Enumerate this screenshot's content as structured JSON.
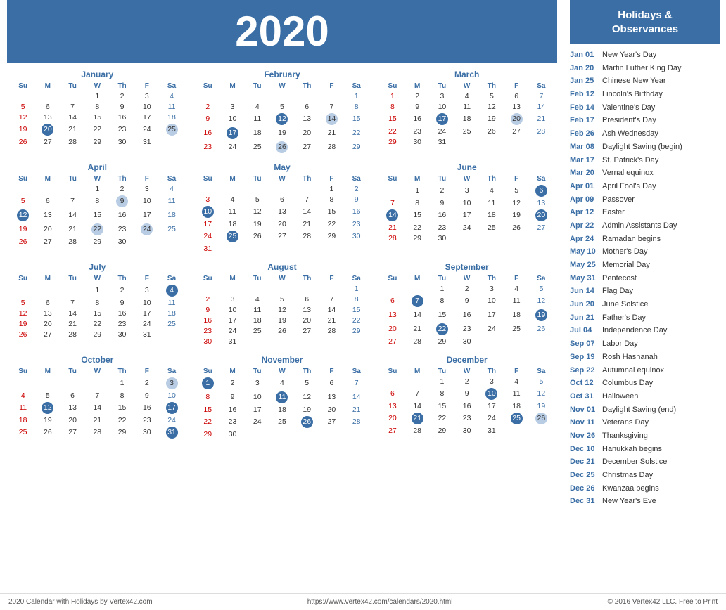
{
  "year": "2020",
  "sidebar_title": "Holidays &\nObservances",
  "footer": {
    "left": "2020 Calendar with Holidays by Vertex42.com",
    "center": "https://www.vertex42.com/calendars/2020.html",
    "right": "© 2016 Vertex42 LLC. Free to Print"
  },
  "holidays": [
    {
      "date": "Jan 01",
      "name": "New Year's Day"
    },
    {
      "date": "Jan 20",
      "name": "Martin Luther King Day"
    },
    {
      "date": "Jan 25",
      "name": "Chinese New Year"
    },
    {
      "date": "Feb 12",
      "name": "Lincoln's Birthday"
    },
    {
      "date": "Feb 14",
      "name": "Valentine's Day"
    },
    {
      "date": "Feb 17",
      "name": "President's Day"
    },
    {
      "date": "Feb 26",
      "name": "Ash Wednesday"
    },
    {
      "date": "Mar 08",
      "name": "Daylight Saving (begin)"
    },
    {
      "date": "Mar 17",
      "name": "St. Patrick's Day"
    },
    {
      "date": "Mar 20",
      "name": "Vernal equinox"
    },
    {
      "date": "Apr 01",
      "name": "April Fool's Day"
    },
    {
      "date": "Apr 09",
      "name": "Passover"
    },
    {
      "date": "Apr 12",
      "name": "Easter"
    },
    {
      "date": "Apr 22",
      "name": "Admin Assistants Day"
    },
    {
      "date": "Apr 24",
      "name": "Ramadan begins"
    },
    {
      "date": "May 10",
      "name": "Mother's Day"
    },
    {
      "date": "May 25",
      "name": "Memorial Day"
    },
    {
      "date": "May 31",
      "name": "Pentecost"
    },
    {
      "date": "Jun 14",
      "name": "Flag Day"
    },
    {
      "date": "Jun 20",
      "name": "June Solstice"
    },
    {
      "date": "Jun 21",
      "name": "Father's Day"
    },
    {
      "date": "Jul 04",
      "name": "Independence Day"
    },
    {
      "date": "Sep 07",
      "name": "Labor Day"
    },
    {
      "date": "Sep 19",
      "name": "Rosh Hashanah"
    },
    {
      "date": "Sep 22",
      "name": "Autumnal equinox"
    },
    {
      "date": "Oct 12",
      "name": "Columbus Day"
    },
    {
      "date": "Oct 31",
      "name": "Halloween"
    },
    {
      "date": "Nov 01",
      "name": "Daylight Saving (end)"
    },
    {
      "date": "Nov 11",
      "name": "Veterans Day"
    },
    {
      "date": "Nov 26",
      "name": "Thanksgiving"
    },
    {
      "date": "Dec 10",
      "name": "Hanukkah begins"
    },
    {
      "date": "Dec 21",
      "name": "December Solstice"
    },
    {
      "date": "Dec 25",
      "name": "Christmas Day"
    },
    {
      "date": "Dec 26",
      "name": "Kwanzaa begins"
    },
    {
      "date": "Dec 31",
      "name": "New Year's Eve"
    }
  ],
  "months": [
    {
      "name": "January",
      "days_of_week": [
        "Su",
        "M",
        "Tu",
        "W",
        "Th",
        "F",
        "Sa"
      ],
      "weeks": [
        [
          null,
          null,
          null,
          1,
          2,
          3,
          4
        ],
        [
          5,
          6,
          7,
          8,
          9,
          10,
          11
        ],
        [
          12,
          13,
          14,
          15,
          16,
          17,
          18
        ],
        [
          19,
          "20h",
          21,
          22,
          23,
          24,
          "25l"
        ],
        [
          26,
          27,
          28,
          29,
          30,
          31,
          null
        ]
      ]
    },
    {
      "name": "February",
      "days_of_week": [
        "Su",
        "M",
        "Tu",
        "W",
        "Th",
        "F",
        "Sa"
      ],
      "weeks": [
        [
          null,
          null,
          null,
          null,
          null,
          null,
          1
        ],
        [
          2,
          3,
          4,
          5,
          6,
          7,
          8
        ],
        [
          9,
          10,
          11,
          "12h",
          13,
          "14l",
          15
        ],
        [
          16,
          "17h",
          18,
          19,
          20,
          21,
          22
        ],
        [
          23,
          24,
          25,
          "26l",
          27,
          28,
          29
        ]
      ]
    },
    {
      "name": "March",
      "days_of_week": [
        "Su",
        "M",
        "Tu",
        "W",
        "Th",
        "F",
        "Sa"
      ],
      "weeks": [
        [
          1,
          2,
          3,
          4,
          5,
          6,
          7
        ],
        [
          8,
          9,
          10,
          11,
          12,
          13,
          14
        ],
        [
          15,
          16,
          "17h",
          18,
          19,
          "20l",
          21
        ],
        [
          22,
          23,
          24,
          25,
          26,
          27,
          28
        ],
        [
          29,
          30,
          31,
          null,
          null,
          null,
          null
        ]
      ]
    },
    {
      "name": "April",
      "days_of_week": [
        "Su",
        "M",
        "Tu",
        "W",
        "Th",
        "F",
        "Sa"
      ],
      "weeks": [
        [
          null,
          null,
          null,
          1,
          2,
          3,
          4
        ],
        [
          5,
          6,
          7,
          8,
          "9l",
          10,
          11
        ],
        [
          "12h",
          13,
          14,
          15,
          16,
          17,
          18
        ],
        [
          19,
          20,
          21,
          "22l",
          23,
          "24l",
          25
        ],
        [
          26,
          27,
          28,
          29,
          30,
          null,
          null
        ]
      ]
    },
    {
      "name": "May",
      "days_of_week": [
        "Su",
        "M",
        "Tu",
        "W",
        "Th",
        "F",
        "Sa"
      ],
      "weeks": [
        [
          null,
          null,
          null,
          null,
          null,
          1,
          2
        ],
        [
          3,
          4,
          5,
          6,
          7,
          8,
          9
        ],
        [
          "10h",
          11,
          12,
          13,
          14,
          15,
          16
        ],
        [
          17,
          18,
          19,
          20,
          21,
          22,
          23
        ],
        [
          24,
          "25h",
          26,
          27,
          28,
          29,
          30
        ],
        [
          31,
          null,
          null,
          null,
          null,
          null,
          null
        ]
      ]
    },
    {
      "name": "June",
      "days_of_week": [
        "Su",
        "M",
        "Tu",
        "W",
        "Th",
        "F",
        "Sa"
      ],
      "weeks": [
        [
          null,
          1,
          2,
          3,
          4,
          5,
          "6h"
        ],
        [
          7,
          8,
          9,
          10,
          11,
          12,
          13
        ],
        [
          "14h",
          15,
          16,
          17,
          18,
          19,
          "20h"
        ],
        [
          21,
          22,
          23,
          24,
          25,
          26,
          27
        ],
        [
          28,
          29,
          30,
          null,
          null,
          null,
          null
        ]
      ]
    },
    {
      "name": "July",
      "days_of_week": [
        "Su",
        "M",
        "Tu",
        "W",
        "Th",
        "F",
        "Sa"
      ],
      "weeks": [
        [
          null,
          null,
          null,
          1,
          2,
          3,
          "4h"
        ],
        [
          5,
          6,
          7,
          8,
          9,
          10,
          11
        ],
        [
          12,
          13,
          14,
          15,
          16,
          17,
          18
        ],
        [
          19,
          20,
          21,
          22,
          23,
          24,
          25
        ],
        [
          26,
          27,
          28,
          29,
          30,
          31,
          null
        ]
      ]
    },
    {
      "name": "August",
      "days_of_week": [
        "Su",
        "M",
        "Tu",
        "W",
        "Th",
        "F",
        "Sa"
      ],
      "weeks": [
        [
          null,
          null,
          null,
          null,
          null,
          null,
          1
        ],
        [
          2,
          3,
          4,
          5,
          6,
          7,
          8
        ],
        [
          9,
          10,
          11,
          12,
          13,
          14,
          15
        ],
        [
          16,
          17,
          18,
          19,
          20,
          21,
          22
        ],
        [
          23,
          24,
          25,
          26,
          27,
          28,
          29
        ],
        [
          30,
          31,
          null,
          null,
          null,
          null,
          null
        ]
      ]
    },
    {
      "name": "September",
      "days_of_week": [
        "Su",
        "M",
        "Tu",
        "W",
        "Th",
        "F",
        "Sa"
      ],
      "weeks": [
        [
          null,
          null,
          1,
          2,
          3,
          4,
          5
        ],
        [
          6,
          "7h",
          8,
          9,
          10,
          11,
          12
        ],
        [
          13,
          14,
          15,
          16,
          17,
          18,
          "19h"
        ],
        [
          20,
          21,
          "22h",
          23,
          24,
          25,
          26
        ],
        [
          27,
          28,
          29,
          30,
          null,
          null,
          null
        ]
      ]
    },
    {
      "name": "October",
      "days_of_week": [
        "Su",
        "M",
        "Tu",
        "W",
        "Th",
        "F",
        "Sa"
      ],
      "weeks": [
        [
          null,
          null,
          null,
          null,
          1,
          2,
          "3l"
        ],
        [
          4,
          5,
          6,
          7,
          8,
          9,
          10
        ],
        [
          11,
          "12h",
          13,
          14,
          15,
          16,
          "17h"
        ],
        [
          18,
          19,
          20,
          21,
          22,
          23,
          24
        ],
        [
          25,
          26,
          27,
          28,
          29,
          30,
          "31h"
        ]
      ]
    },
    {
      "name": "November",
      "days_of_week": [
        "Su",
        "M",
        "Tu",
        "W",
        "Th",
        "F",
        "Sa"
      ],
      "weeks": [
        [
          "1h",
          2,
          3,
          4,
          5,
          6,
          7
        ],
        [
          8,
          9,
          10,
          "11h",
          12,
          13,
          14
        ],
        [
          15,
          16,
          17,
          18,
          19,
          20,
          21
        ],
        [
          22,
          23,
          24,
          25,
          "26h",
          27,
          28
        ],
        [
          29,
          30,
          null,
          null,
          null,
          null,
          null
        ]
      ]
    },
    {
      "name": "December",
      "days_of_week": [
        "Su",
        "M",
        "Tu",
        "W",
        "Th",
        "F",
        "Sa"
      ],
      "weeks": [
        [
          null,
          null,
          1,
          2,
          3,
          4,
          5
        ],
        [
          6,
          7,
          8,
          9,
          "10h",
          11,
          12
        ],
        [
          13,
          14,
          15,
          16,
          17,
          18,
          19
        ],
        [
          20,
          "21h",
          22,
          23,
          24,
          "25h",
          "26l"
        ],
        [
          27,
          28,
          29,
          30,
          31,
          null,
          null
        ]
      ]
    }
  ]
}
